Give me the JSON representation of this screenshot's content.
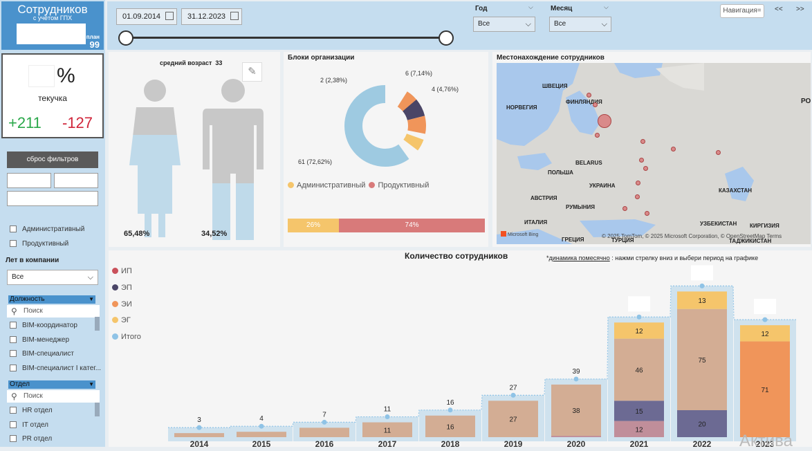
{
  "header": {
    "title": "Сотрудников",
    "subtitle": "с учётом ГПХ",
    "plan_label": "план",
    "plan_value": "99"
  },
  "turnover": {
    "percent_sign": "%",
    "label": "текучка",
    "plus": "+211",
    "minus": "-127"
  },
  "sidebar": {
    "reset_label": "сброс фильтров",
    "blocks": [
      "Административный",
      "Продуктивный"
    ],
    "years_label": "Лет в компании",
    "years_value": "Все",
    "position_label": "Должность",
    "position_search": "Поиск",
    "positions": [
      "BIM-координатор",
      "BIM-менеджер",
      "BIM-специалист",
      "BIM-специалист I катег..."
    ],
    "dept_label": "Отдел",
    "dept_search": "Поиск",
    "departments": [
      "HR отдел",
      "IT отдел",
      "PR отдел"
    ]
  },
  "filters": {
    "date_from": "01.09.2014",
    "date_to": "31.12.2023",
    "year_label": "Год",
    "year_value": "Все",
    "month_label": "Месяц",
    "month_value": "Все",
    "nav_label": "Навигация=",
    "prev_label": "<<",
    "next_label": ">>"
  },
  "age_panel": {
    "title": "средний возраст",
    "value": "33",
    "female_pct": "65,48%",
    "male_pct": "34,52%"
  },
  "blocks_panel": {
    "title": "Блоки организации",
    "slices": [
      {
        "label": "61 (72,62%)",
        "value": 61,
        "color": "#9ecae1"
      },
      {
        "label": "2 (2,38%)",
        "value": 2,
        "color": "#5aa2d6"
      },
      {
        "label": "",
        "value": 5,
        "color": "#f0955a"
      },
      {
        "label": "6 (7,14%)",
        "value": 6,
        "color": "#4a4566"
      },
      {
        "label": "",
        "value": 6,
        "color": "#f0955a"
      },
      {
        "label": "4 (4,76%)",
        "value": 4,
        "color": "#f5c56b"
      }
    ],
    "legend": [
      {
        "name": "Административный",
        "color": "#f5c56b"
      },
      {
        "name": "Продуктивный",
        "color": "#d87a7a"
      }
    ],
    "bar": [
      {
        "label": "26%",
        "value": 26,
        "color": "#f5c56b"
      },
      {
        "label": "74%",
        "value": 74,
        "color": "#d87a7a"
      }
    ]
  },
  "map_panel": {
    "title": "Местонахождение сотрудников",
    "labels": [
      "ШВЕЦИЯ",
      "ФИНЛЯНДИЯ",
      "НОРВЕГИЯ",
      "РО",
      "BELARUS",
      "ПОЛЬША",
      "УКРАИНА",
      "АВСТРИЯ",
      "РУМЫНИЯ",
      "ИТАЛИЯ",
      "КАЗАХСТАН",
      "УЗБЕКИСТАН",
      "КИРГИЗИЯ",
      "ТАДЖИКИСТАН",
      "ТУРЦИЯ",
      "ГРЕЦИЯ"
    ],
    "attribution": "© 2025 TomTom, © 2025 Microsoft Corporation, © OpenStreetMap  Terms",
    "bing": "Microsoft Bing"
  },
  "count_chart": {
    "title": "Количество сотрудников",
    "hint_prefix": "*",
    "hint_link": "динамика помесячно",
    "hint_rest": " : нажми стрелку вниз и выбери период на графике",
    "legend": [
      {
        "name": "ИП",
        "color": "#c9505a"
      },
      {
        "name": "ЭП",
        "color": "#4a4566"
      },
      {
        "name": "ЭИ",
        "color": "#f0955a"
      },
      {
        "name": "ЭГ",
        "color": "#f5c56b"
      },
      {
        "name": "Итого",
        "color": "#8fc3e6"
      }
    ],
    "watermark": "Актива"
  },
  "chart_data": {
    "type": "bar",
    "categories": [
      "2014",
      "2015",
      "2016",
      "2017",
      "2018",
      "2019",
      "2020",
      "2021",
      "2022",
      "2023"
    ],
    "series": [
      {
        "name": "ИП",
        "values": [
          0,
          0,
          0,
          0,
          0,
          0,
          1,
          12,
          0,
          0
        ]
      },
      {
        "name": "ЭП",
        "values": [
          0,
          0,
          0,
          0,
          0,
          0,
          0,
          15,
          20,
          0
        ]
      },
      {
        "name": "ЭИ",
        "values": [
          3,
          4,
          7,
          11,
          16,
          27,
          38,
          46,
          75,
          71
        ]
      },
      {
        "name": "ЭГ",
        "values": [
          0,
          0,
          0,
          0,
          0,
          0,
          0,
          12,
          13,
          12
        ]
      },
      {
        "name": "Итого",
        "values": [
          3,
          4,
          7,
          11,
          16,
          27,
          39,
          null,
          null,
          null
        ]
      }
    ],
    "bar_labels": {
      "ИП": [
        null,
        null,
        null,
        null,
        null,
        null,
        null,
        "12",
        null,
        null
      ],
      "ЭП": [
        null,
        null,
        null,
        null,
        null,
        null,
        null,
        "15",
        "20",
        null
      ],
      "ЭИ": [
        null,
        null,
        null,
        "11",
        "16",
        "27",
        "38",
        "46",
        "75",
        "71"
      ],
      "ЭГ": [
        null,
        null,
        null,
        null,
        null,
        null,
        null,
        "12",
        "13",
        "12"
      ]
    },
    "title": "Количество сотрудников",
    "xlabel": "",
    "ylabel": ""
  }
}
